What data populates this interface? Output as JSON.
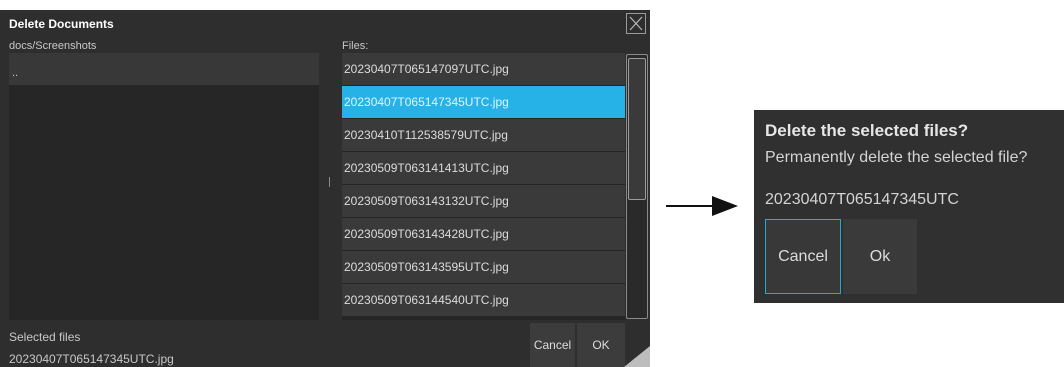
{
  "window": {
    "title": "Delete Documents",
    "folder_path": "docs/Screenshots",
    "files_label": "Files:",
    "dir_items": [
      ".."
    ],
    "files": [
      {
        "name": "20230407T065147097UTC.jpg",
        "selected": false
      },
      {
        "name": "20230407T065147345UTC.jpg",
        "selected": true
      },
      {
        "name": "20230410T112538579UTC.jpg",
        "selected": false
      },
      {
        "name": "20230509T063141413UTC.jpg",
        "selected": false
      },
      {
        "name": "20230509T063143132UTC.jpg",
        "selected": false
      },
      {
        "name": "20230509T063143428UTC.jpg",
        "selected": false
      },
      {
        "name": "20230509T063143595UTC.jpg",
        "selected": false
      },
      {
        "name": "20230509T063144540UTC.jpg",
        "selected": false
      }
    ],
    "selected_files_label": "Selected files",
    "selected_file_value": "20230407T065147345UTC.jpg",
    "cancel_label": "Cancel",
    "ok_label": "OK"
  },
  "confirm_dialog": {
    "title": "Delete the selected files?",
    "message": "Permanently delete the selected file?",
    "file_name": "20230407T065147345UTC",
    "cancel_label": "Cancel",
    "ok_label": "Ok"
  },
  "icons": {
    "close": "close-icon",
    "arrow": "arrow-right-icon",
    "resize": "resize-grip-icon"
  },
  "colors": {
    "window_bg": "#2e2e2e",
    "selection": "#26b2e6",
    "focus_border": "#27a9d6"
  }
}
